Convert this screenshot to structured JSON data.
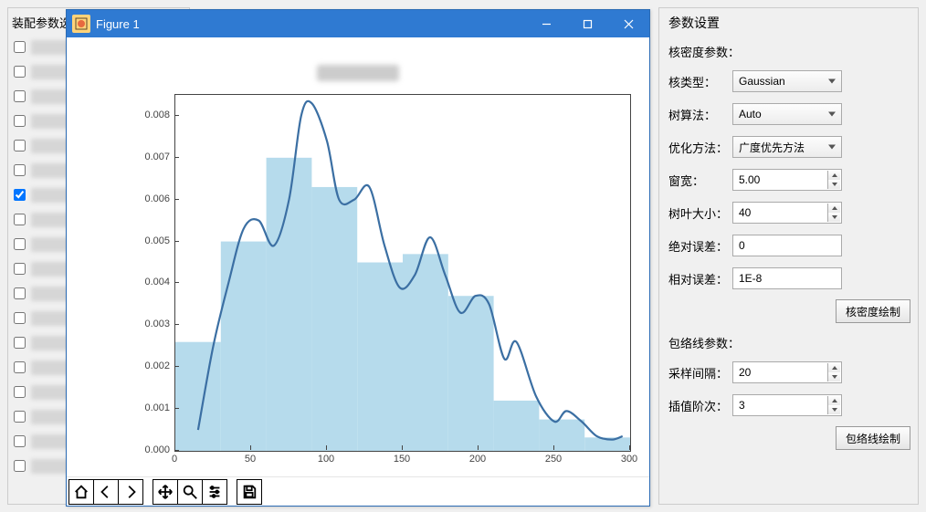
{
  "left_panel": {
    "title": "装配参数选",
    "items": [
      {
        "checked": false
      },
      {
        "checked": false
      },
      {
        "checked": false
      },
      {
        "checked": false
      },
      {
        "checked": false
      },
      {
        "checked": false
      },
      {
        "checked": true
      },
      {
        "checked": false
      },
      {
        "checked": false
      },
      {
        "checked": false
      },
      {
        "checked": false
      },
      {
        "checked": false
      },
      {
        "checked": false
      },
      {
        "checked": false
      },
      {
        "checked": false
      },
      {
        "checked": false
      },
      {
        "checked": false
      },
      {
        "checked": false
      }
    ]
  },
  "right_panel": {
    "title": "参数设置",
    "kde": {
      "heading": "核密度参数：",
      "kernel_label": "核类型：",
      "kernel_value": "Gaussian",
      "tree_label": "树算法：",
      "tree_value": "Auto",
      "opt_label": "优化方法：",
      "opt_value": "广度优先方法",
      "bandwidth_label": "窗宽：",
      "bandwidth_value": "5.00",
      "leaf_label": "树叶大小：",
      "leaf_value": "40",
      "atol_label": "绝对误差：",
      "atol_value": "0",
      "rtol_label": "相对误差：",
      "rtol_value": "1E-8",
      "draw_button": "核密度绘制"
    },
    "envelope": {
      "heading": "包络线参数：",
      "samp_label": "采样间隔：",
      "samp_value": "20",
      "interp_label": "插值阶次：",
      "interp_value": "3",
      "draw_button": "包络线绘制"
    }
  },
  "figure_window": {
    "title": "Figure 1",
    "toolbar": {
      "home": "home-icon",
      "back": "back-icon",
      "fwd": "forward-icon",
      "pan": "pan-icon",
      "zoom": "zoom-icon",
      "config": "config-icon",
      "save": "save-icon"
    }
  },
  "chart_data": {
    "type": "bar_with_line",
    "title": "(blurred)",
    "xlabel": "",
    "ylabel": "",
    "x_ticks": [
      0,
      50,
      100,
      150,
      200,
      250,
      300
    ],
    "y_ticks": [
      0.0,
      0.001,
      0.002,
      0.003,
      0.004,
      0.005,
      0.006,
      0.007,
      0.008
    ],
    "xlim": [
      0,
      300
    ],
    "ylim": [
      0.0,
      0.0085
    ],
    "histogram": {
      "bin_width": 30,
      "categories": [
        15,
        45,
        75,
        105,
        135,
        165,
        195,
        225,
        255,
        285
      ],
      "values": [
        0.0026,
        0.005,
        0.007,
        0.0063,
        0.0045,
        0.0047,
        0.0037,
        0.0012,
        0.00075,
        0.00032
      ]
    },
    "kde_line": {
      "x": [
        15,
        25,
        35,
        45,
        55,
        65,
        75,
        83,
        90,
        100,
        108,
        118,
        128,
        138,
        148,
        158,
        168,
        178,
        188,
        198,
        207,
        217,
        225,
        238,
        250,
        258,
        268,
        278,
        288,
        295
      ],
      "y": [
        0.0005,
        0.0025,
        0.004,
        0.0053,
        0.0055,
        0.0049,
        0.006,
        0.008,
        0.0083,
        0.0074,
        0.006,
        0.006,
        0.0063,
        0.0049,
        0.0039,
        0.0042,
        0.0051,
        0.0042,
        0.0033,
        0.0037,
        0.0035,
        0.0022,
        0.0026,
        0.0013,
        0.0007,
        0.00095,
        0.0007,
        0.00035,
        0.00027,
        0.00035
      ]
    }
  }
}
